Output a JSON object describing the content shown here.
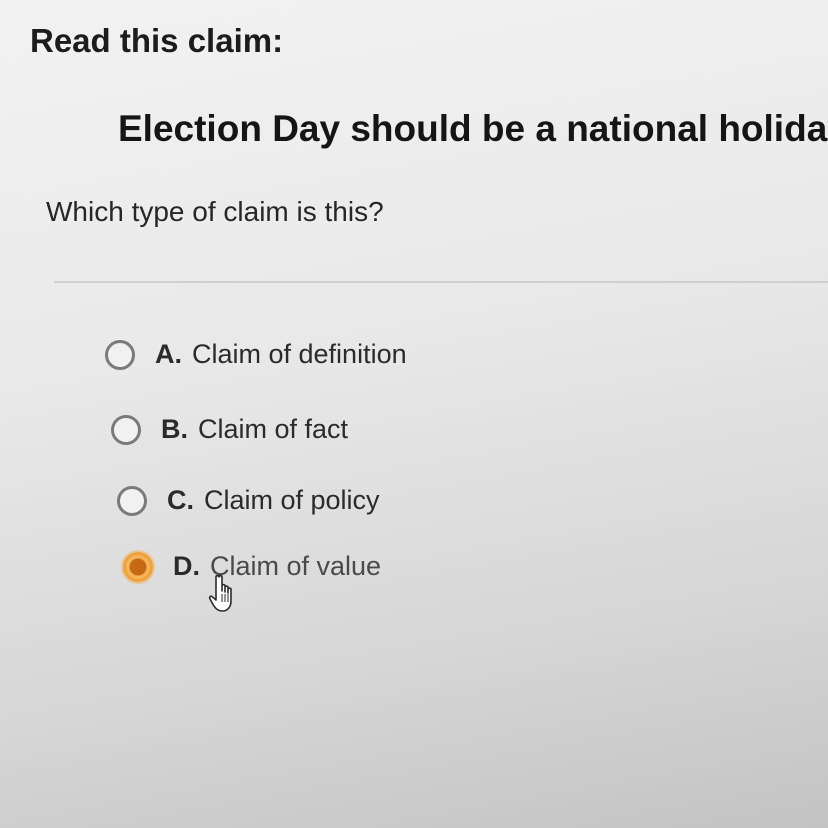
{
  "header": {
    "prompt": "Read this claim:",
    "claim": "Election Day should be a national holiday."
  },
  "question": "Which type of claim is this?",
  "options": [
    {
      "letter": "A.",
      "label": "Claim of definition",
      "selected": false
    },
    {
      "letter": "B.",
      "label": "Claim of fact",
      "selected": false
    },
    {
      "letter": "C.",
      "label": "Claim of policy",
      "selected": false
    },
    {
      "letter": "D.",
      "label": "Claim of value",
      "selected": true
    }
  ],
  "colors": {
    "selected_radio": "#f0a23a",
    "radio_border": "#7a7a7a"
  },
  "cursor_icon": "hand-pointer-icon"
}
